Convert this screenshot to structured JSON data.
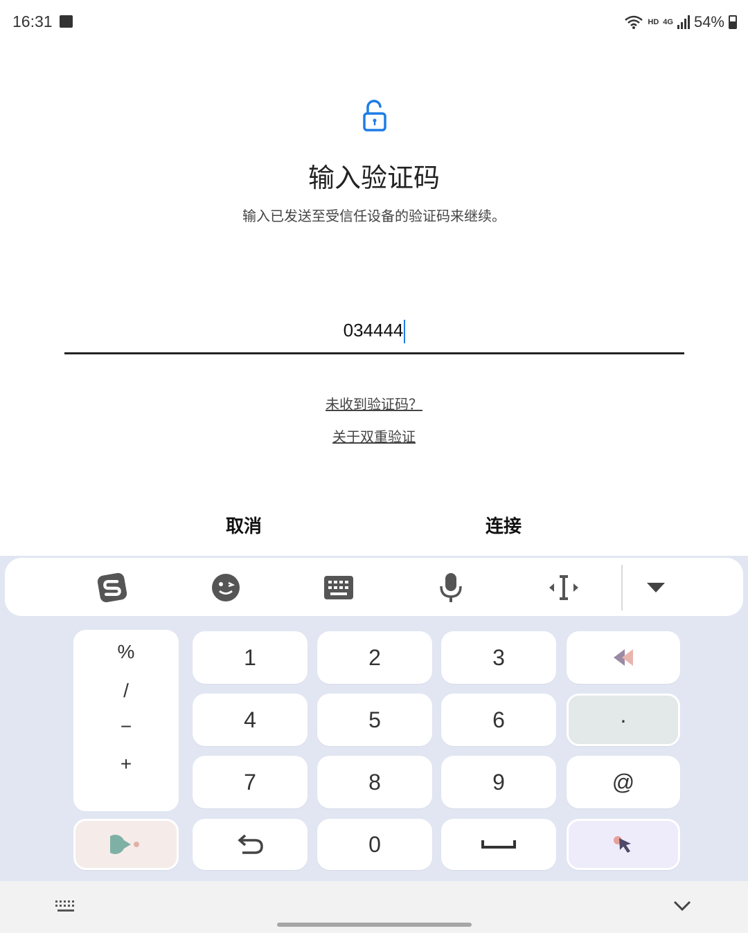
{
  "status_bar": {
    "time": "16:31",
    "hd": "HD",
    "network": "4G",
    "battery": "54%",
    "icons": [
      "image-icon",
      "wifi-icon",
      "signal-icon",
      "battery-icon"
    ]
  },
  "page": {
    "title": "输入验证码",
    "subtitle": "输入已发送至受信任设备的验证码来继续。",
    "code_value": "034444",
    "links": {
      "not_received": "未收到验证码？",
      "about_2fa": "关于双重验证"
    },
    "buttons": {
      "cancel": "取消",
      "connect": "连接"
    },
    "accent_color": "#1e7ce6"
  },
  "keyboard": {
    "toolbar_icons": [
      "sogou-logo-icon",
      "emoji-icon",
      "keyboard-icon",
      "microphone-icon",
      "cursor-move-icon",
      "collapse-icon"
    ],
    "symbols": [
      "%",
      "/",
      "−",
      "+"
    ],
    "digits": [
      "1",
      "2",
      "3",
      "4",
      "5",
      "6",
      "7",
      "8",
      "9",
      "0"
    ],
    "keys": {
      "dot": "·",
      "at": "@"
    },
    "special_icons": [
      "backspace-icon",
      "game-icon",
      "undo-icon",
      "space-icon",
      "cursor-pointer-icon"
    ]
  },
  "navbar": {
    "icons": [
      "keyboard-grid-icon",
      "chevron-down-icon"
    ]
  }
}
